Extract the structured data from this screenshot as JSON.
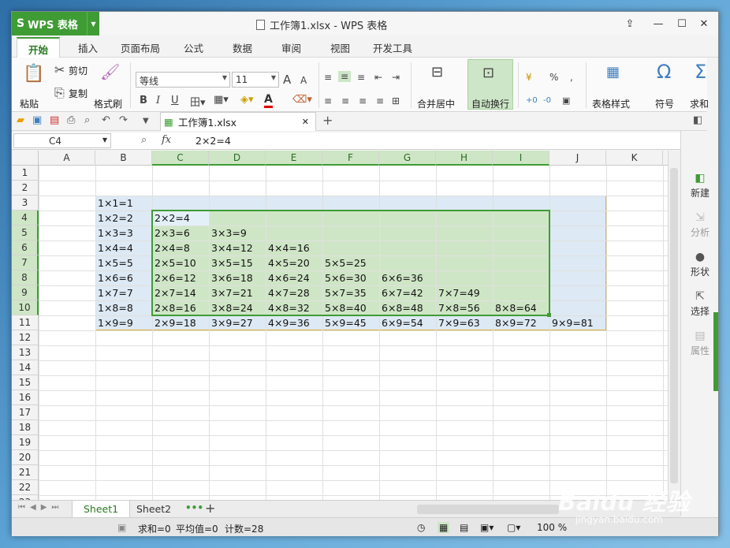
{
  "app": {
    "name": "WPS 表格",
    "title": "工作簿1.xlsx - WPS 表格"
  },
  "tabs": [
    "开始",
    "插入",
    "页面布局",
    "公式",
    "数据",
    "审阅",
    "视图",
    "开发工具"
  ],
  "ribbon": {
    "paste": "粘贴",
    "cut": "剪切",
    "copy": "复制",
    "format_painter": "格式刷",
    "font_name": "等线",
    "font_size": "11",
    "bold": "B",
    "italic": "I",
    "underline": "U",
    "font_color": "A",
    "merge_center": "合并居中",
    "wrap_text": "自动换行",
    "table_style": "表格样式",
    "symbol": "符号",
    "sum": "求和",
    "percent": "%",
    "increase_font": "A",
    "decrease_font": "A",
    "currency": "¥",
    "thousands": ",",
    "inc_decimal": "+0",
    "dec_decimal": "-0",
    "omega": "Ω",
    "sigma": "Σ"
  },
  "doc_tab": "工作簿1.xlsx",
  "formula": {
    "name_box": "C4",
    "fx": "fx",
    "content": "2×2=4"
  },
  "columns": [
    "A",
    "B",
    "C",
    "D",
    "E",
    "F",
    "G",
    "H",
    "I",
    "J",
    "K"
  ],
  "rows": [
    "1",
    "2",
    "3",
    "4",
    "5",
    "6",
    "7",
    "8",
    "9",
    "10",
    "11",
    "12",
    "13",
    "14",
    "15",
    "16",
    "17",
    "18",
    "19",
    "20",
    "21",
    "22",
    "23"
  ],
  "cells": [
    [
      "",
      "",
      "",
      "",
      "",
      "",
      "",
      "",
      "",
      ""
    ],
    [
      "",
      "",
      "",
      "",
      "",
      "",
      "",
      "",
      "",
      ""
    ],
    [
      "1×1=1",
      "",
      "",
      "",
      "",
      "",
      "",
      "",
      "",
      ""
    ],
    [
      "1×2=2",
      "2×2=4",
      "",
      "",
      "",
      "",
      "",
      "",
      "",
      ""
    ],
    [
      "1×3=3",
      "2×3=6",
      "3×3=9",
      "",
      "",
      "",
      "",
      "",
      "",
      ""
    ],
    [
      "1×4=4",
      "2×4=8",
      "3×4=12",
      "4×4=16",
      "",
      "",
      "",
      "",
      "",
      ""
    ],
    [
      "1×5=5",
      "2×5=10",
      "3×5=15",
      "4×5=20",
      "5×5=25",
      "",
      "",
      "",
      "",
      ""
    ],
    [
      "1×6=6",
      "2×6=12",
      "3×6=18",
      "4×6=24",
      "5×6=30",
      "6×6=36",
      "",
      "",
      "",
      ""
    ],
    [
      "1×7=7",
      "2×7=14",
      "3×7=21",
      "4×7=28",
      "5×7=35",
      "6×7=42",
      "7×7=49",
      "",
      "",
      ""
    ],
    [
      "1×8=8",
      "2×8=16",
      "3×8=24",
      "4×8=32",
      "5×8=40",
      "6×8=48",
      "7×8=56",
      "8×8=64",
      "",
      ""
    ],
    [
      "1×9=9",
      "2×9=18",
      "3×9=27",
      "4×9=36",
      "5×9=45",
      "6×9=54",
      "7×9=63",
      "8×9=72",
      "9×9=81",
      ""
    ]
  ],
  "right_panel": {
    "new": "新建",
    "analyze": "分析",
    "shape": "形状",
    "select": "选择",
    "properties": "属性"
  },
  "sheets": [
    "Sheet1",
    "Sheet2"
  ],
  "status": {
    "sum": "求和=0",
    "average": "平均值=0",
    "count": "计数=28",
    "zoom": "100 %"
  },
  "watermark": {
    "brand": "Baidu 经验",
    "url": "jingyan.baidu.com"
  },
  "colors": {
    "accent": "#3f9c35",
    "selection": "#cfe6c6",
    "copy_range": "#dde9f4"
  }
}
